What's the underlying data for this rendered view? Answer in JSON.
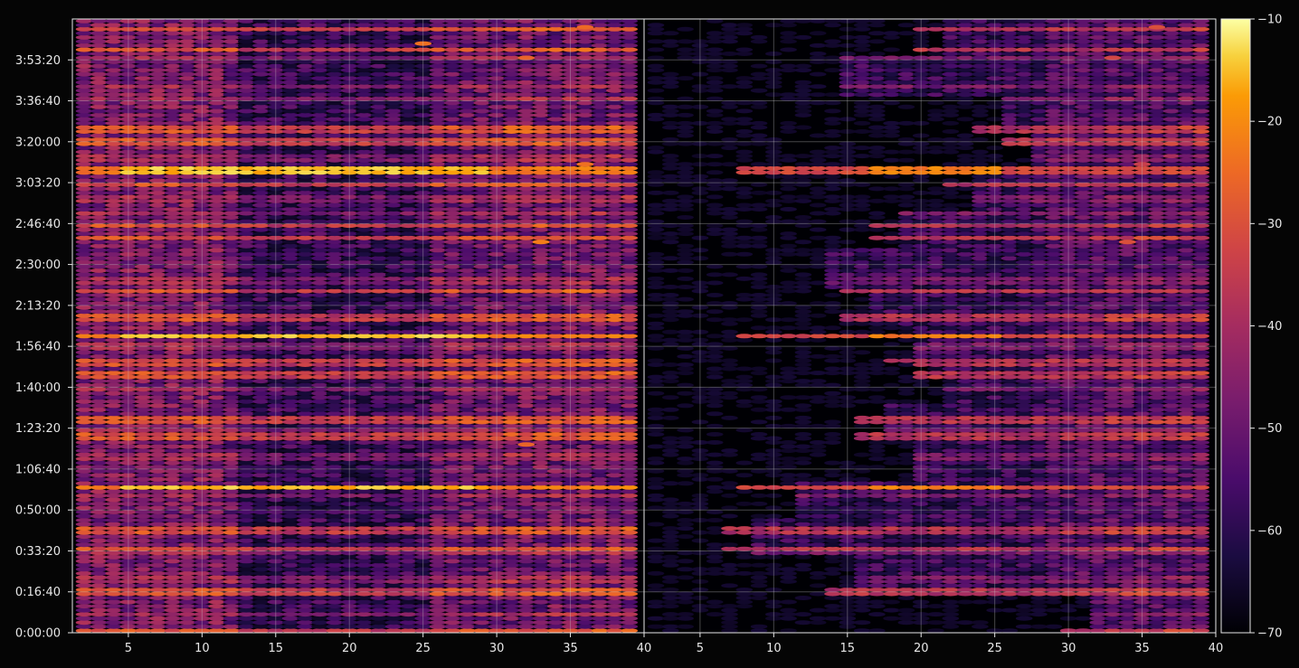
{
  "chart_data": {
    "type": "heatmap",
    "title": "",
    "xlabel": "",
    "ylabel": "",
    "panels": [
      {
        "name": "",
        "x_range": [
          1.2,
          40
        ],
        "x_ticks": [
          "5",
          "10",
          "15",
          "20",
          "25",
          "30",
          "35",
          "40"
        ],
        "x_tick_values": [
          5,
          10,
          15,
          20,
          25,
          30,
          35,
          40
        ]
      },
      {
        "name": "",
        "x_range": [
          1.2,
          40
        ],
        "x_ticks": [
          "5",
          "10",
          "15",
          "20",
          "25",
          "30",
          "35",
          "40"
        ],
        "x_tick_values": [
          5,
          10,
          15,
          20,
          25,
          30,
          35,
          40
        ]
      }
    ],
    "y_range_seconds": [
      0,
      15000
    ],
    "y_ticks": [
      "0:00:00",
      "0:16:40",
      "0:33:20",
      "0:50:00",
      "1:06:40",
      "1:23:20",
      "1:40:00",
      "1:56:40",
      "2:13:20",
      "2:30:00",
      "2:46:40",
      "3:03:20",
      "3:20:00",
      "3:36:40",
      "3:53:20"
    ],
    "y_tick_values": [
      0,
      1000,
      2000,
      3000,
      4000,
      5000,
      6000,
      7000,
      8000,
      9000,
      10000,
      11000,
      12000,
      13000,
      14000
    ],
    "grid": true,
    "colormap": "inferno",
    "colorbar": {
      "range": [
        -70,
        -10
      ],
      "ticks": [
        "−10",
        "−20",
        "−30",
        "−40",
        "−50",
        "−60",
        "−70"
      ],
      "tick_values": [
        -10,
        -20,
        -30,
        -40,
        -50,
        -60,
        -70
      ]
    },
    "strong_rows_seconds": {
      "left_peak": [
        3550,
        7250,
        11300
      ],
      "right_peak": [
        3550,
        7250,
        11300
      ],
      "bright": [
        0,
        950,
        1000,
        2050,
        2500,
        4800,
        5200,
        6300,
        6600,
        7700,
        8350,
        9650,
        9950,
        10950,
        12000,
        12300,
        14250,
        14750
      ],
      "medium": [
        450,
        1300,
        1950,
        3350,
        4300,
        4900,
        5950,
        7000,
        8600,
        10250,
        10600,
        11600,
        13050,
        13350,
        14050
      ]
    },
    "right_panel_onset_x": [
      [
        2,
        30
      ],
      [
        4,
        14
      ],
      [
        7,
        7
      ],
      [
        9,
        10
      ],
      [
        11,
        18
      ],
      [
        13,
        16
      ],
      [
        15,
        20
      ],
      [
        17,
        18
      ],
      [
        19,
        15
      ],
      [
        21,
        12
      ],
      [
        23,
        17
      ],
      [
        25,
        22
      ],
      [
        27,
        26
      ],
      [
        29,
        24
      ],
      [
        31,
        13
      ],
      [
        33,
        20
      ]
    ],
    "hot_spots": [
      {
        "panel": 0,
        "x": 33,
        "y": 9550,
        "v": -22
      },
      {
        "panel": 0,
        "x": 36,
        "y": 11450,
        "v": -24
      },
      {
        "panel": 0,
        "x": 32,
        "y": 14050,
        "v": -26
      },
      {
        "panel": 0,
        "x": 25,
        "y": 14400,
        "v": -24
      },
      {
        "panel": 0,
        "x": 32,
        "y": 4600,
        "v": -26
      },
      {
        "panel": 0,
        "x": 36,
        "y": 14800,
        "v": -25
      },
      {
        "panel": 1,
        "x": 34,
        "y": 9550,
        "v": -30
      },
      {
        "panel": 1,
        "x": 33,
        "y": 14050,
        "v": -32
      },
      {
        "panel": 1,
        "x": 36,
        "y": 14800,
        "v": -30
      },
      {
        "panel": 1,
        "x": 35,
        "y": 11450,
        "v": -34
      }
    ]
  }
}
